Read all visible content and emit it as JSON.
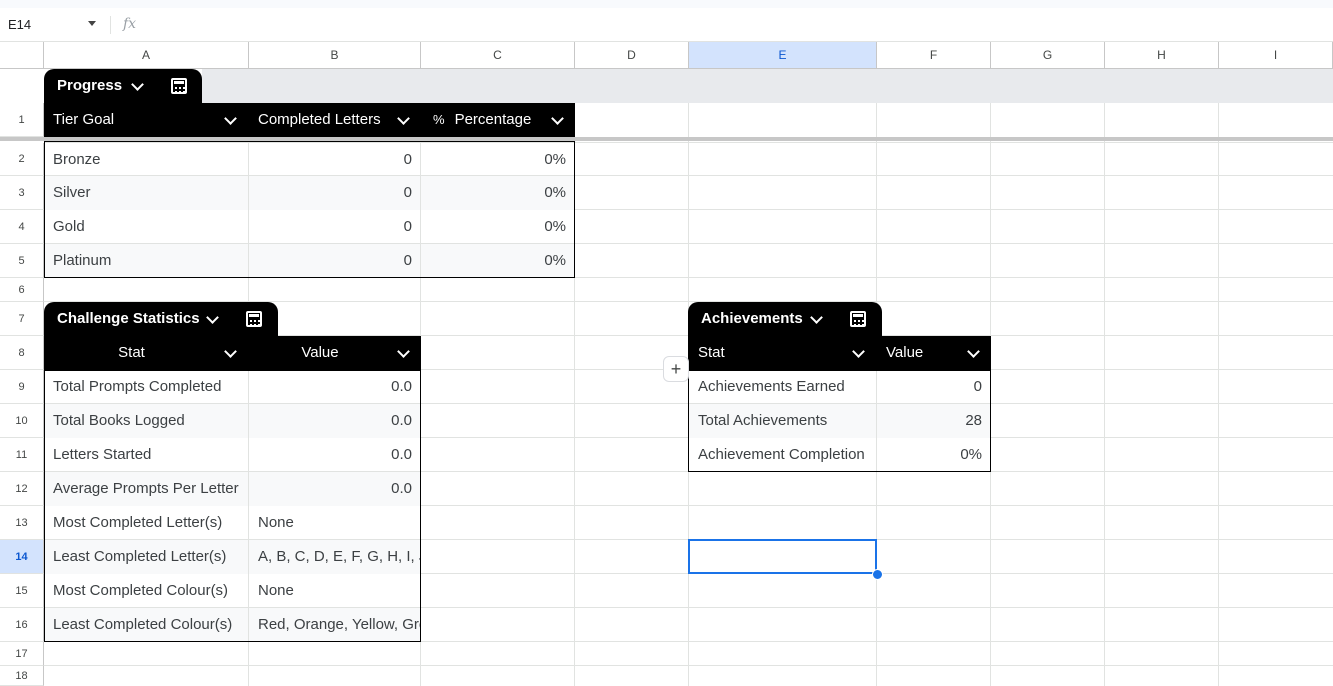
{
  "formula_bar": {
    "name_box": "E14",
    "fx": "fx",
    "formula": ""
  },
  "columns": [
    "A",
    "B",
    "C",
    "D",
    "E",
    "F",
    "G",
    "H",
    "I"
  ],
  "selected_column": "E",
  "rows": [
    "1",
    "2",
    "3",
    "4",
    "5",
    "6",
    "7",
    "8",
    "9",
    "10",
    "11",
    "12",
    "13",
    "14",
    "15",
    "16",
    "17",
    "18"
  ],
  "selected_row": "14",
  "selected_cell": "E14",
  "progress_table": {
    "name": "Progress",
    "headers": [
      "Tier Goal",
      "Completed Letters",
      "Percentage"
    ],
    "percent_icon": "%",
    "rows": [
      {
        "tier": "Bronze",
        "completed": "0",
        "percentage": "0%"
      },
      {
        "tier": "Silver",
        "completed": "0",
        "percentage": "0%"
      },
      {
        "tier": "Gold",
        "completed": "0",
        "percentage": "0%"
      },
      {
        "tier": "Platinum",
        "completed": "0",
        "percentage": "0%"
      }
    ]
  },
  "challenge_table": {
    "name": "Challenge Statistics",
    "headers": [
      "Stat",
      "Value"
    ],
    "rows": [
      {
        "stat": "Total Prompts Completed",
        "value": "0.0"
      },
      {
        "stat": "Total Books Logged",
        "value": "0.0"
      },
      {
        "stat": "Letters Started",
        "value": "0.0"
      },
      {
        "stat": "Average Prompts Per Letter",
        "value": "0.0"
      },
      {
        "stat": "Most Completed Letter(s)",
        "value": "None"
      },
      {
        "stat": "Least Completed Letter(s)",
        "value": "A, B, C, D, E, F, G, H, I, J, K"
      },
      {
        "stat": "Most Completed Colour(s)",
        "value": "None"
      },
      {
        "stat": "Least Completed Colour(s)",
        "value": "Red, Orange, Yellow, Green"
      }
    ]
  },
  "achievements_table": {
    "name": "Achievements",
    "headers": [
      "Stat",
      "Value"
    ],
    "rows": [
      {
        "stat": "Achievements Earned",
        "value": "0"
      },
      {
        "stat": "Total Achievements",
        "value": "28"
      },
      {
        "stat": "Achievement Completion",
        "value": "0%"
      }
    ]
  },
  "add_button": "+"
}
